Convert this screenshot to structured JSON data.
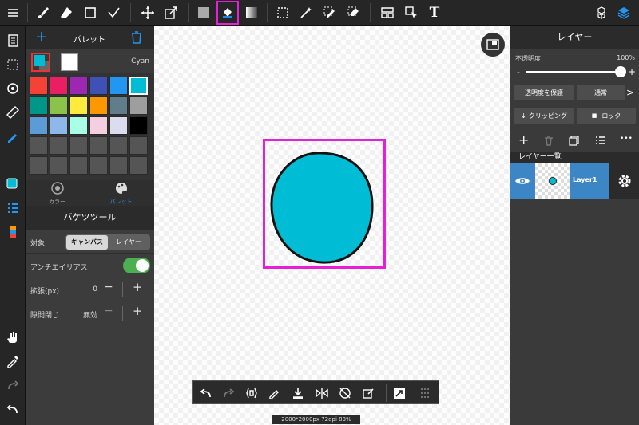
{
  "toolbar": {
    "selected_tool": "bucket-tool",
    "highlight_color": "#e81fd9",
    "text_tool_glyph": "T"
  },
  "palette": {
    "title": "パレット",
    "current_color_name": "Cyan",
    "current_color": "#00bcd4",
    "swatches": [
      "#f44336",
      "#e91e63",
      "#9c27b0",
      "#3f51b5",
      "#2196f3",
      "#00bcd4",
      "#009688",
      "#8bc34a",
      "#ffeb3b",
      "#ff9800",
      "#607d8b",
      "#9e9e9e",
      "#5c9bd5",
      "#8db8ea",
      "#a8ffe5",
      "#f5cfe0",
      "#dcdcf0",
      "#000000",
      "#555555",
      "#555555",
      "#555555",
      "#555555",
      "#555555",
      "#555555",
      "#555555",
      "#555555",
      "#555555",
      "#555555",
      "#555555",
      "#555555"
    ]
  },
  "tabs": {
    "color": "カラー",
    "palette": "パレット"
  },
  "bucket": {
    "title": "バケツツール",
    "target_label": "対象",
    "target_canvas": "キャンバス",
    "target_layer": "レイヤー",
    "antialias_label": "アンチエイリアス",
    "antialias_on": true,
    "expand_label": "拡張(px)",
    "expand_value": "0",
    "gap_label": "隙間閉じ",
    "gap_value": "無効",
    "minus": "−",
    "plus": "+"
  },
  "canvas": {
    "status": "2000*2000px 72dpi 83%",
    "circle_color": "#00bcd4"
  },
  "layers": {
    "title": "レイヤー",
    "opacity_label": "不透明度",
    "opacity_value": "100%",
    "opacity_fraction": 1.0,
    "minus": "-",
    "plus": "+",
    "protect_label": "透明度を保護",
    "blend_label": "通常",
    "blend_arrow": ">",
    "clipping_label": "クリッピング",
    "lock_label": "ロック",
    "list_title": "レイヤー一覧",
    "layer_name": "Layer1",
    "more": "•••"
  }
}
